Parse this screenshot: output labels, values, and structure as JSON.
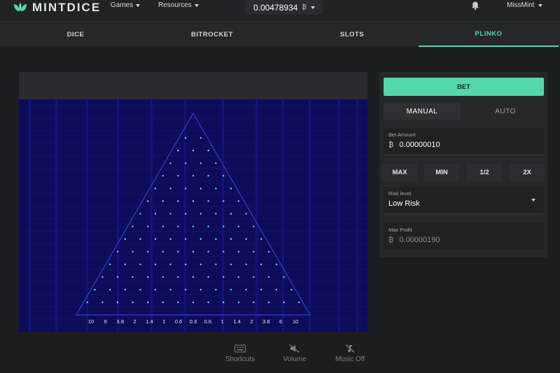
{
  "header": {
    "logo_text": "MINTDICE",
    "nav": [
      {
        "label": "Games"
      },
      {
        "label": "Resources"
      }
    ],
    "balance": "0.00478934",
    "currency_symbol": "₿",
    "username": "MissMint",
    "icons": [
      "mint-leaf-logo-icon",
      "caret-down-icon",
      "bitcoin-icon",
      "bell-icon"
    ]
  },
  "tabs": [
    {
      "label": "DICE",
      "active": false
    },
    {
      "label": "BITROCKET",
      "active": false
    },
    {
      "label": "SLOTS",
      "active": false
    },
    {
      "label": "PLINKO",
      "active": true
    }
  ],
  "board": {
    "multipliers": [
      "10",
      "6",
      "3.8",
      "2",
      "1.4",
      "1",
      "0.6",
      "0.3",
      "0.6",
      "1",
      "1.4",
      "2",
      "3.8",
      "6",
      "10"
    ],
    "peg_rows": 14
  },
  "controls": [
    {
      "label": "Shortcuts",
      "icon": "keyboard-icon"
    },
    {
      "label": "Volume",
      "icon": "volume-muted-icon"
    },
    {
      "label": "Music Off",
      "icon": "music-off-icon"
    }
  ],
  "panel": {
    "bet_label": "BET",
    "modes": [
      {
        "label": "MANUAL",
        "active": true
      },
      {
        "label": "AUTO",
        "active": false
      }
    ],
    "bet_amount": {
      "label": "Bet Amount",
      "value": "0.00000010"
    },
    "quick_buttons": [
      "MAX",
      "MIN",
      "1/2",
      "2X"
    ],
    "risk": {
      "label": "Risk level",
      "value": "Low Risk"
    },
    "max_profit": {
      "label": "Max Profit",
      "value": "0.00000190"
    }
  },
  "colors": {
    "accent": "#56d7b1",
    "board_bg": "#0c0c5a",
    "peg": "#7fd6ff",
    "page_bg": "#1c1d21"
  }
}
